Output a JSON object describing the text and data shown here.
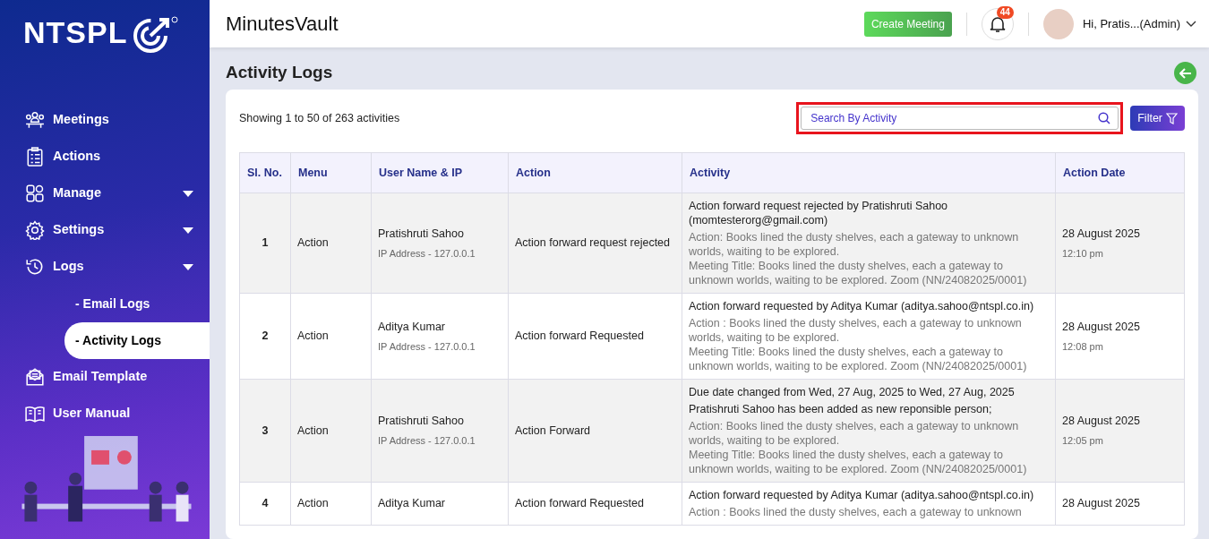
{
  "brand": {
    "name": "NTSPL"
  },
  "sidebar": {
    "items": [
      {
        "label": "Meetings",
        "kind": "plain"
      },
      {
        "label": "Actions",
        "kind": "plain"
      },
      {
        "label": "Manage",
        "kind": "group"
      },
      {
        "label": "Settings",
        "kind": "group"
      },
      {
        "label": "Logs",
        "kind": "group",
        "children": [
          {
            "label": "- Email Logs",
            "selected": false
          },
          {
            "label": "- Activity Logs",
            "selected": true
          }
        ]
      },
      {
        "label": "Email Template",
        "kind": "plain"
      },
      {
        "label": "User Manual",
        "kind": "plain"
      }
    ]
  },
  "header": {
    "title": "MinutesVault",
    "create_button": "Create Meeting",
    "notification_count": "44",
    "user_label": "Hi, Pratis...(Admin)"
  },
  "page": {
    "title": "Activity Logs",
    "summary": "Showing 1 to 50 of 263 activities",
    "search": {
      "placeholder": "Search By Activity",
      "highlighted": true
    },
    "filter_button": "Filter"
  },
  "table": {
    "columns": [
      "Sl. No.",
      "Menu",
      "User Name & IP",
      "Action",
      "Activity",
      "Action Date"
    ],
    "rows": [
      {
        "sl": "1",
        "menu": "Action",
        "user": "Pratishruti Sahoo",
        "ip": "IP Address - 127.0.0.1",
        "action": "Action forward request rejected",
        "headlines": [
          "Action forward request rejected by Pratishruti Sahoo (momtesterorg@gmail.com)"
        ],
        "details": [
          "Action: Books lined the dusty shelves, each a gateway to unknown worlds, waiting to be explored.",
          "Meeting Title: Books lined the dusty shelves, each a gateway to unknown worlds, waiting to be explored. Zoom (NN/24082025/0001)"
        ],
        "date": "28 August 2025",
        "time": "12:10 pm"
      },
      {
        "sl": "2",
        "menu": "Action",
        "user": "Aditya Kumar",
        "ip": "IP Address - 127.0.0.1",
        "action": "Action forward Requested",
        "headlines": [
          "Action forward requested by Aditya Kumar (aditya.sahoo@ntspl.co.in)"
        ],
        "details": [
          "Action : Books lined the dusty shelves, each a gateway to unknown worlds, waiting to be explored.",
          "Meeting Title: Books lined the dusty shelves, each a gateway to unknown worlds, waiting to be explored. Zoom (NN/24082025/0001)"
        ],
        "date": "28 August 2025",
        "time": "12:08 pm"
      },
      {
        "sl": "3",
        "menu": "Action",
        "user": "Pratishruti Sahoo",
        "ip": "IP Address - 127.0.0.1",
        "action": "Action Forward",
        "headlines": [
          "Due date changed from Wed, 27 Aug, 2025 to Wed, 27 Aug, 2025",
          "Pratishruti Sahoo has been added as new reponsible person;"
        ],
        "details": [
          "Action: Books lined the dusty shelves, each a gateway to unknown worlds, waiting to be explored.",
          "Meeting Title: Books lined the dusty shelves, each a gateway to unknown worlds, waiting to be explored. Zoom (NN/24082025/0001)"
        ],
        "date": "28 August 2025",
        "time": "12:05 pm"
      },
      {
        "sl": "4",
        "menu": "Action",
        "user": "Aditya Kumar",
        "action": "Action forward Requested",
        "headlines": [
          "Action forward requested by Aditya Kumar (aditya.sahoo@ntspl.co.in)"
        ],
        "details": [
          "Action : Books lined the dusty shelves, each a gateway to unknown"
        ],
        "date": "28 August 2025"
      }
    ]
  }
}
